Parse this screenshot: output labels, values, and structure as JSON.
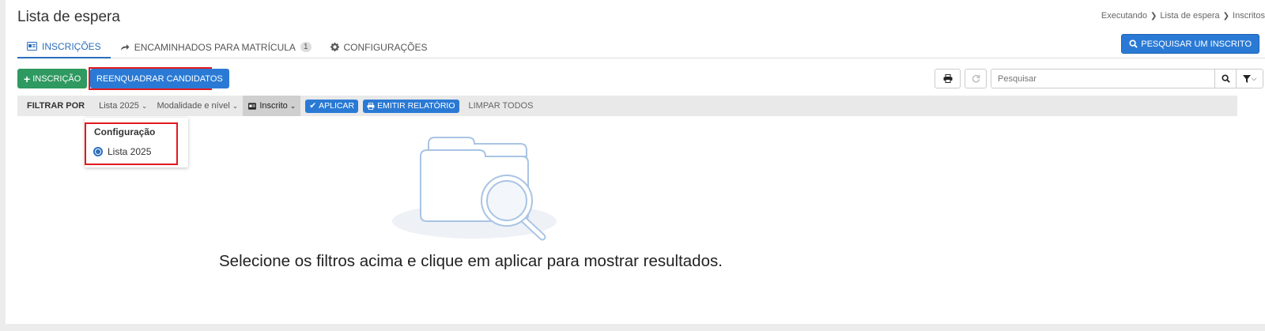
{
  "header": {
    "title": "Lista de espera",
    "breadcrumb": [
      "Executando",
      "Lista de espera",
      "Inscritos"
    ]
  },
  "tabs": [
    {
      "label": "INSCRIÇÕES",
      "icon": "id-card-icon",
      "active": true
    },
    {
      "label": "ENCAMINHADOS PARA MATRÍCULA",
      "icon": "share-icon",
      "badge": "1"
    },
    {
      "label": "CONFIGURAÇÕES",
      "icon": "gear-icon"
    }
  ],
  "search_inscrito_label": "PESQUISAR UM INSCRITO",
  "toolbar": {
    "add_label": "INSCRIÇÃO",
    "reenquadrar_label": "REENQUADRAR CANDIDATOS",
    "search_placeholder": "Pesquisar"
  },
  "filters": {
    "label": "FILTRAR POR",
    "items": [
      "Lista 2025",
      "Modalidade e nível",
      "Inscrito"
    ],
    "apply_label": "APLICAR",
    "report_label": "EMITIR RELATÓRIO",
    "clear_label": "LIMPAR TODOS"
  },
  "dropdown": {
    "heading": "Configuração",
    "option": "Lista 2025"
  },
  "empty_state": {
    "message": "Selecione os filtros acima e clique em aplicar para mostrar resultados."
  },
  "colors": {
    "primary": "#2a7ad5",
    "success": "#2e9960",
    "highlight": "#e0191f"
  }
}
